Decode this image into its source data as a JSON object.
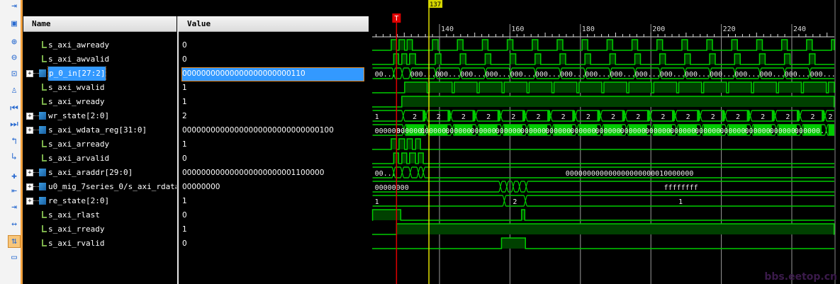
{
  "columns": {
    "name": "Name",
    "value": "Value"
  },
  "toolbar": [
    "expand-icon",
    "save-icon",
    "zoom-in-icon",
    "zoom-out-icon",
    "zoom-fit-icon",
    "zoom-cursor-icon",
    "go-to-start-icon",
    "go-to-end-icon",
    "previous-transition-icon",
    "next-transition-icon",
    "add-marker-icon",
    "previous-marker-icon",
    "next-marker-icon",
    "swap-cursors-icon",
    "snap-to-transition-icon",
    "floating-ruler-icon"
  ],
  "cursor": {
    "label": "137",
    "time": 137,
    "color": "#e0e000"
  },
  "marker": {
    "label": "T",
    "time": 127.8,
    "color": "#e00000"
  },
  "ruler": {
    "labels": [
      "140",
      "160",
      "180",
      "200",
      "220",
      "240"
    ],
    "start": 121,
    "end": 251
  },
  "colors": {
    "wave": "#00cc00",
    "fill": "#004000",
    "grid": "#9a9a9a"
  },
  "watermark": "bbs.eetop.cn",
  "rows": [
    {
      "name": "s_axi_awready",
      "value": "0",
      "bus": false,
      "wave": {
        "type": "bit",
        "init": 0,
        "highs": [
          [
            126.3,
            127.8
          ],
          [
            128.5,
            130.1
          ],
          [
            130.8,
            132.3
          ]
        ],
        "periodic": {
          "start": 138.0,
          "width": 1.6,
          "period": 7.08,
          "until": 252
        }
      }
    },
    {
      "name": "s_axi_awvalid",
      "value": "0",
      "bus": false,
      "wave": {
        "type": "bit",
        "init": 0,
        "highs": [
          [
            127.0,
            128.4
          ],
          [
            129.3,
            130.7
          ],
          [
            131.5,
            133.2
          ]
        ],
        "periodic": {
          "start": 138.8,
          "width": 1.6,
          "period": 7.08,
          "until": 252
        }
      }
    },
    {
      "name": "p_0_in[27:2]",
      "value": "00000000000000000000000110",
      "bus": true,
      "selected": true,
      "wave": {
        "type": "bus",
        "trans": [
          127.0,
          129.4,
          131.7
        ],
        "periodic": {
          "start": 138.9,
          "period": 7.08,
          "until": 252
        },
        "labels": [
          "00...",
          "...",
          "...",
          "000..."
        ]
      }
    },
    {
      "name": "s_axi_wvalid",
      "value": "1",
      "bus": false,
      "wave": {
        "type": "bit",
        "init": 0,
        "highs": [
          [
            130.1,
            136.5
          ]
        ],
        "periodic": {
          "start": 137.1,
          "width": 6.5,
          "period": 7.08,
          "until": 252
        }
      }
    },
    {
      "name": "s_axi_wready",
      "value": "1",
      "bus": false,
      "wave": {
        "type": "bit",
        "init": 0,
        "highs": [
          [
            129.3,
            252
          ]
        ]
      }
    },
    {
      "name": "wr_state[2:0]",
      "value": "2",
      "bus": true,
      "wave": {
        "type": "bus",
        "trans": [
          129.7
        ],
        "periodic": {
          "start": 136.2,
          "period": 7.08,
          "until": 252,
          "block": 1.2
        },
        "labels": [
          "1",
          "2"
        ]
      }
    },
    {
      "name": "s_axi_wdata_reg[31:0]",
      "value": "00000000000000000000000000000100",
      "bus": true,
      "wave": {
        "type": "fbus",
        "trans": [
          129.9
        ],
        "periodic": {
          "start": 136.5,
          "period": 7.08,
          "until": 252,
          "gap": 1.3
        },
        "labels": [
          "000000..."
        ]
      }
    },
    {
      "name": "s_axi_arready",
      "value": "1",
      "bus": false,
      "wave": {
        "type": "bit",
        "init": 0,
        "highs": [
          [
            126.3,
            127.8
          ],
          [
            128.5,
            130.1
          ],
          [
            130.8,
            132.3
          ],
          [
            133.2,
            134.6
          ]
        ]
      }
    },
    {
      "name": "s_axi_arvalid",
      "value": "0",
      "bus": false,
      "wave": {
        "type": "bit",
        "init": 0,
        "highs": [
          [
            127.0,
            128.4
          ],
          [
            129.3,
            130.7
          ],
          [
            131.5,
            133.2
          ],
          [
            134.0,
            135.4
          ]
        ]
      }
    },
    {
      "name": "s_axi_araddr[29:0]",
      "value": "000000000000000000000001100000",
      "bus": true,
      "wave": {
        "type": "bus",
        "trans": [
          127.0,
          129.4,
          131.7,
          134.0,
          135.4
        ],
        "labels": [
          "00...",
          "...",
          "...",
          "...",
          "",
          "000000000000000000000010000000"
        ]
      }
    },
    {
      "name": "u0_mig_7series_0/s_axi_rdata[31:0]",
      "value": "00000000",
      "bus": true,
      "wave": {
        "type": "bus",
        "trans": [
          157.3,
          159.1,
          160.9,
          162.7,
          164.6
        ],
        "labels": [
          "00000000",
          "",
          "",
          "",
          "",
          "ffffffff"
        ]
      }
    },
    {
      "name": "re_state[2:0]",
      "value": "1",
      "bus": true,
      "wave": {
        "type": "bus",
        "trans": [
          158.4,
          164.4
        ],
        "labels": [
          "1",
          "2",
          "1"
        ]
      }
    },
    {
      "name": "s_axi_rlast",
      "value": "0",
      "bus": false,
      "wave": {
        "type": "bit",
        "init": 1,
        "highs": [
          [
            121,
            129.0
          ],
          [
            163.3,
            164.2
          ]
        ]
      }
    },
    {
      "name": "s_axi_rready",
      "value": "1",
      "bus": false,
      "wave": {
        "type": "bit",
        "init": 0,
        "highs": [
          [
            127.8,
            252
          ]
        ]
      }
    },
    {
      "name": "s_axi_rvalid",
      "value": "0",
      "bus": false,
      "wave": {
        "type": "bit",
        "init": 0,
        "highs": [
          [
            157.6,
            164.4
          ]
        ]
      }
    }
  ]
}
